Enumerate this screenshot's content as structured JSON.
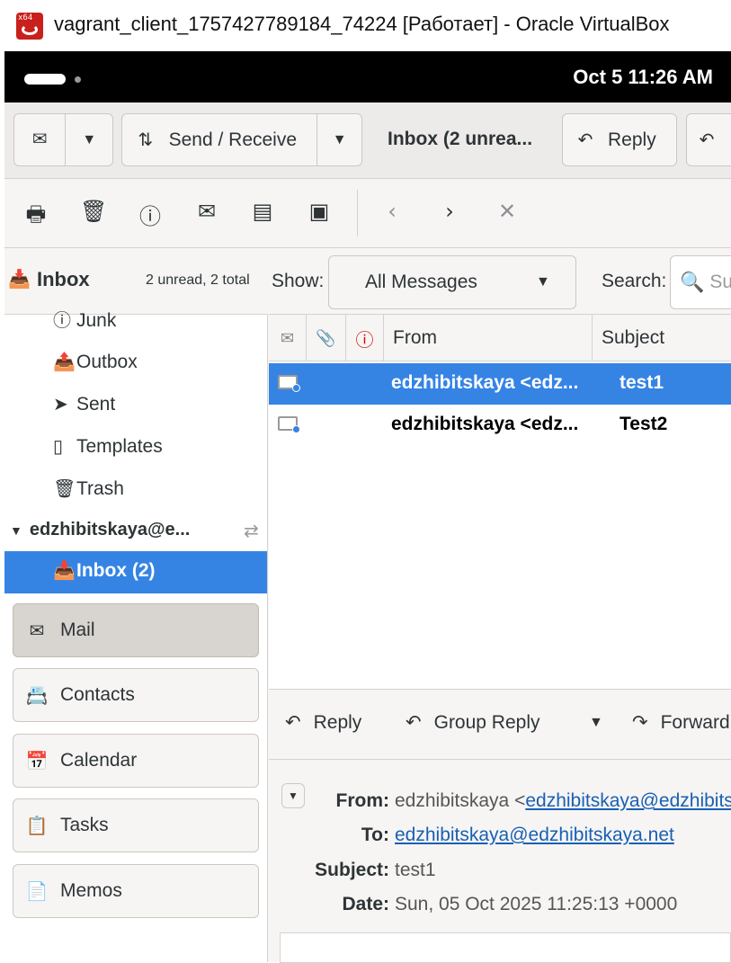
{
  "window": {
    "title": "vagrant_client_1757427789184_74224 [Работает] - Oracle VirtualBox",
    "icon_label": "x64"
  },
  "topbar": {
    "clock": "Oct 5  11:26 AM"
  },
  "toolbar": {
    "new_icon": "mail-new-icon",
    "send_receive_label": "Send / Receive",
    "folder_status": "Inbox (2 unrea...",
    "reply_label": "Reply"
  },
  "sidebar": {
    "header_title": "Inbox",
    "header_counts": "2 unread, 2 total",
    "folders": [
      {
        "label": "Junk"
      },
      {
        "label": "Outbox"
      },
      {
        "label": "Sent"
      },
      {
        "label": "Templates"
      },
      {
        "label": "Trash"
      }
    ],
    "account": "edzhibitskaya@e...",
    "selected_folder": "Inbox (2)",
    "nav": [
      {
        "label": "Mail"
      },
      {
        "label": "Contacts"
      },
      {
        "label": "Calendar"
      },
      {
        "label": "Tasks"
      },
      {
        "label": "Memos"
      }
    ]
  },
  "filter": {
    "show_label": "Show:",
    "show_value": "All Messages",
    "search_label": "Search:",
    "search_placeholder": "Su"
  },
  "columns": {
    "from": "From",
    "subject": "Subject"
  },
  "messages": [
    {
      "from": "edzhibitskaya <edz...",
      "subject": "test1"
    },
    {
      "from": "edzhibitskaya <edz...",
      "subject": "Test2"
    }
  ],
  "preview": {
    "reply_label": "Reply",
    "group_reply_label": "Group Reply",
    "forward_label": "Forward",
    "from_label": "From:",
    "from_name": "edzhibitskaya <",
    "from_email": "edzhibitskaya@edzhibits",
    "to_label": "To:",
    "to_email": "edzhibitskaya@edzhibitskaya.net",
    "subject_label": "Subject:",
    "subject_value": "test1",
    "date_label": "Date:",
    "date_value": "Sun, 05 Oct 2025 11:25:13 +0000"
  }
}
